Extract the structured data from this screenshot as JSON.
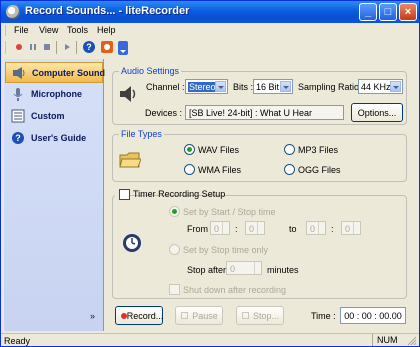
{
  "window": {
    "title": "Record Sounds... - liteRecorder"
  },
  "menu": {
    "file": "File",
    "view": "View",
    "tools": "Tools",
    "help": "Help"
  },
  "toolbar": {
    "icons": [
      "record-icon",
      "pause-icon",
      "stop-icon",
      "play-icon",
      "help-icon",
      "record-app-icon"
    ]
  },
  "sidebar": {
    "items": [
      {
        "label": "Computer Sound",
        "icon": "speaker-icon"
      },
      {
        "label": "Microphone",
        "icon": "microphone-icon"
      },
      {
        "label": "Custom",
        "icon": "custom-icon"
      },
      {
        "label": "User's Guide",
        "icon": "help-icon"
      }
    ],
    "more": "»"
  },
  "audio": {
    "title": "Audio Settings",
    "channel_label": "Channel :",
    "channel_value": "Stereo",
    "bits_label": "Bits :",
    "bits_value": "16 Bit",
    "sampling_label": "Sampling Ratio :",
    "sampling_value": "44 KHz",
    "devices_label": "Devices :",
    "devices_value": "[SB Live! 24-bit] : What U Hear",
    "options_label": "Options..."
  },
  "filetypes": {
    "title": "File Types",
    "wav": "WAV Files",
    "mp3": "MP3 Files",
    "wma": "WMA Files",
    "ogg": "OGG Files",
    "selected": "wav"
  },
  "timer": {
    "title": "Timer Recording Setup",
    "start_stop_label": "Set by Start / Stop time",
    "from_label": "From",
    "to_label": "to",
    "colon": ":",
    "from_h": "0",
    "from_m": "0",
    "to_h": "0",
    "to_m": "0",
    "stop_time_only_label": "Set by Stop time only",
    "stop_after_label": "Stop after",
    "stop_after_value": "0",
    "minutes_label": "minutes",
    "shutdown_label": "Shut down after recording"
  },
  "controls": {
    "record": "Record...",
    "pause": "Pause",
    "stop": "Stop...",
    "time_label": "Time :",
    "time_value": "00 : 00 : 00.00"
  },
  "status": {
    "text": "Ready",
    "num": "NUM"
  }
}
